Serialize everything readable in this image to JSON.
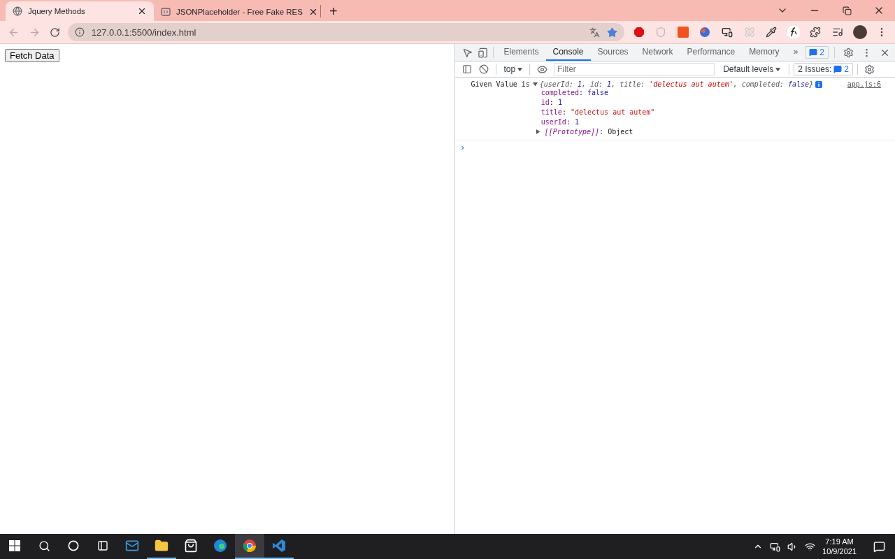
{
  "browser": {
    "tabs": [
      {
        "title": "Jquery Methods",
        "selected": true
      },
      {
        "title": "JSONPlaceholder - Free Fake RES",
        "selected": false
      }
    ],
    "new_tab": "+",
    "address": "127.0.0.1:5500/index.html"
  },
  "page": {
    "button": "Fetch Data"
  },
  "devtools": {
    "tabs": [
      {
        "label": "Elements",
        "selected": false
      },
      {
        "label": "Console",
        "selected": true
      },
      {
        "label": "Sources",
        "selected": false
      },
      {
        "label": "Network",
        "selected": false
      },
      {
        "label": "Performance",
        "selected": false
      },
      {
        "label": "Memory",
        "selected": false
      }
    ],
    "more_tabs": "»",
    "message_count": "2",
    "context": "top",
    "filter": {
      "placeholder": "Filter"
    },
    "levels": "Default levels",
    "issues_label": "2 Issues:",
    "issues_count": "2",
    "log": {
      "prefix": "Given Value is",
      "expanded": true,
      "summary": [
        {
          "text": "{userId: ",
          "kind": "plain"
        },
        {
          "text": "1",
          "kind": "number"
        },
        {
          "text": ", id: ",
          "kind": "plain"
        },
        {
          "text": "1",
          "kind": "number"
        },
        {
          "text": ", title: ",
          "kind": "plain"
        },
        {
          "text": "'delectus aut autem'",
          "kind": "string"
        },
        {
          "text": ", completed: ",
          "kind": "plain"
        },
        {
          "text": "false",
          "kind": "number"
        },
        {
          "text": "}",
          "kind": "plain"
        }
      ],
      "source": "app.js:6",
      "properties": [
        {
          "key": "completed",
          "sep": ":",
          "value": "false",
          "kind": "boolean"
        },
        {
          "key": "id",
          "sep": ":",
          "value": "1",
          "kind": "number"
        },
        {
          "key": "title",
          "sep": ":",
          "value": "\"delectus aut autem\"",
          "kind": "string"
        },
        {
          "key": "userId",
          "sep": ":",
          "value": "1",
          "kind": "number"
        },
        {
          "key": "[[Prototype]]",
          "sep": ":",
          "value": "Object",
          "kind": "prototype",
          "expanded": false
        }
      ]
    },
    "prompt": "›"
  },
  "taskbar": {
    "apps": [
      {
        "kind": "mail",
        "selected": false,
        "running": false
      },
      {
        "kind": "folder",
        "selected": false,
        "running": true
      },
      {
        "kind": "store",
        "selected": false,
        "running": false
      },
      {
        "kind": "edge",
        "selected": false,
        "running": false
      },
      {
        "kind": "chrome",
        "selected": true,
        "running": true
      },
      {
        "kind": "vscode",
        "selected": false,
        "running": true
      }
    ],
    "time": "7:19 AM",
    "date": "10/9/2021"
  }
}
